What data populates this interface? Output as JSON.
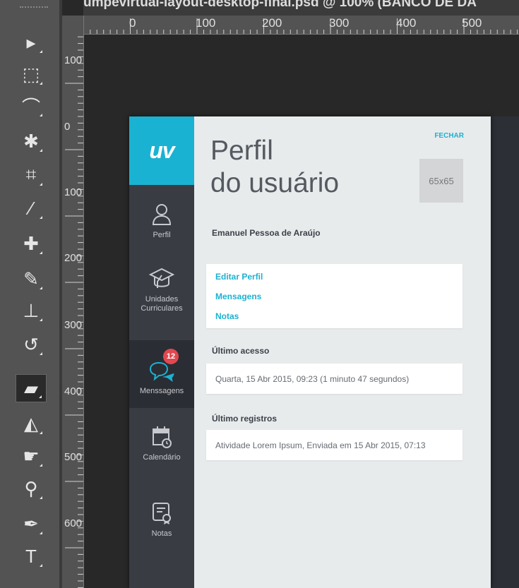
{
  "window": {
    "title": "umpevirtual-layout-desktop-final.psd @ 100% (BANCO DE DA"
  },
  "ruler": {
    "horizontal": [
      "0",
      "100",
      "200",
      "300",
      "400",
      "500"
    ],
    "vertical": [
      "100",
      "0",
      "100",
      "200",
      "300",
      "400",
      "500",
      "600"
    ]
  },
  "tools": [
    {
      "name": "move-tool",
      "glyph": "▸"
    },
    {
      "name": "marquee-tool",
      "glyph": "⬚"
    },
    {
      "name": "lasso-tool",
      "glyph": "⌒"
    },
    {
      "name": "magic-wand-tool",
      "glyph": "✱"
    },
    {
      "name": "crop-tool",
      "glyph": "⌗"
    },
    {
      "name": "eyedropper-tool",
      "glyph": "⁄"
    },
    {
      "name": "healing-brush-tool",
      "glyph": "✚"
    },
    {
      "name": "brush-tool",
      "glyph": "✎"
    },
    {
      "name": "stamp-tool",
      "glyph": "⊥"
    },
    {
      "name": "history-brush-tool",
      "glyph": "↺"
    },
    {
      "name": "eraser-tool",
      "glyph": "▰"
    },
    {
      "name": "paint-bucket-tool",
      "glyph": "◭"
    },
    {
      "name": "smudge-tool",
      "glyph": "☛"
    },
    {
      "name": "zoom-tool",
      "glyph": "⚲"
    },
    {
      "name": "pen-tool",
      "glyph": "✒"
    },
    {
      "name": "type-tool",
      "glyph": "T"
    }
  ],
  "app": {
    "logo": "uv",
    "nav": [
      {
        "label": "Perfil"
      },
      {
        "label": "Unidades Curriculares"
      },
      {
        "label": "Menssagens",
        "badge": "12"
      },
      {
        "label": "Calendário"
      },
      {
        "label": "Notas"
      }
    ],
    "close_label": "FECHAR",
    "title_line1": "Perfil",
    "title_line2": "do usuário",
    "avatar_placeholder": "65x65",
    "user_name": "Emanuel Pessoa de Araújo",
    "links": [
      "Editar Perfil",
      "Mensagens",
      "Notas"
    ],
    "last_access_label": "Último acesso",
    "last_access_value": "Quarta, 15 Abr 2015, 09:23 (1 minuto 47 segundos)",
    "last_records_label": "Último registros",
    "last_records_value": "Atividade Lorem Ipsum, Enviada em 15 Abr 2015, 07:13"
  },
  "colors": {
    "accent": "#1ab2d2",
    "sidebar": "#3a3c44",
    "badge": "#e2484f"
  }
}
